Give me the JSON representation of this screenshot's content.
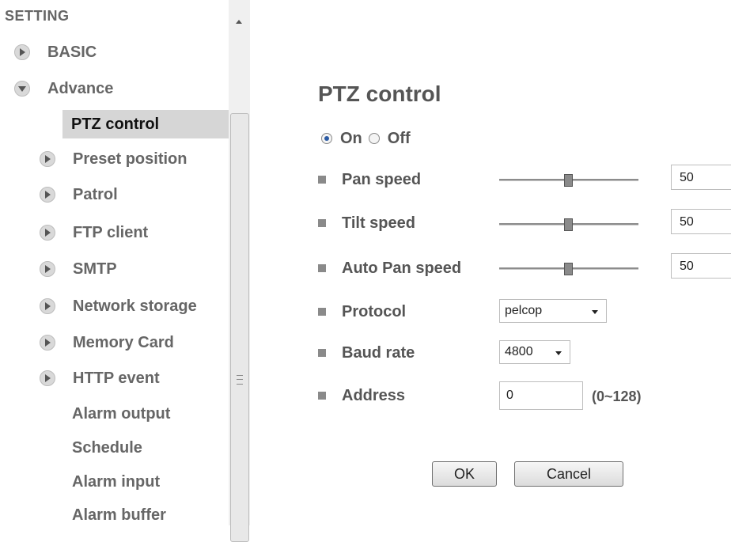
{
  "sidebar": {
    "section_title": "SETTING",
    "items": [
      {
        "label": "BASIC",
        "icon": "chevron-right-circle-icon"
      },
      {
        "label": "Advance",
        "icon": "chevron-down-circle-icon"
      },
      {
        "label": "PTZ control",
        "active": true
      },
      {
        "label": "Preset position",
        "icon": "chevron-right-circle-icon"
      },
      {
        "label": "Patrol",
        "icon": "chevron-right-circle-icon"
      },
      {
        "label": "FTP client",
        "icon": "chevron-right-circle-icon"
      },
      {
        "label": "SMTP",
        "icon": "chevron-right-circle-icon"
      },
      {
        "label": "Network storage",
        "icon": "chevron-right-circle-icon"
      },
      {
        "label": "Memory Card",
        "icon": "chevron-right-circle-icon"
      },
      {
        "label": "HTTP event",
        "icon": "chevron-right-circle-icon"
      },
      {
        "label": "Alarm output"
      },
      {
        "label": "Schedule"
      },
      {
        "label": "Alarm input"
      },
      {
        "label": "Alarm buffer"
      }
    ]
  },
  "main": {
    "title": "PTZ control",
    "mode": {
      "on_label": "On",
      "off_label": "Off",
      "selected": "On"
    },
    "pan_speed": {
      "label": "Pan speed",
      "value": "50"
    },
    "tilt_speed": {
      "label": "Tilt speed",
      "value": "50"
    },
    "auto_pan_speed": {
      "label": "Auto Pan speed",
      "value": "50"
    },
    "protocol": {
      "label": "Protocol",
      "value": "pelcop"
    },
    "baud_rate": {
      "label": "Baud rate",
      "value": "4800"
    },
    "address": {
      "label": "Address",
      "value": "0",
      "range_hint": "(0~128)"
    },
    "buttons": {
      "ok": "OK",
      "cancel": "Cancel"
    }
  },
  "colors": {
    "active_bg": "#d6d6d6",
    "text": "#555555",
    "radio_selected": "#2b5aa3"
  }
}
